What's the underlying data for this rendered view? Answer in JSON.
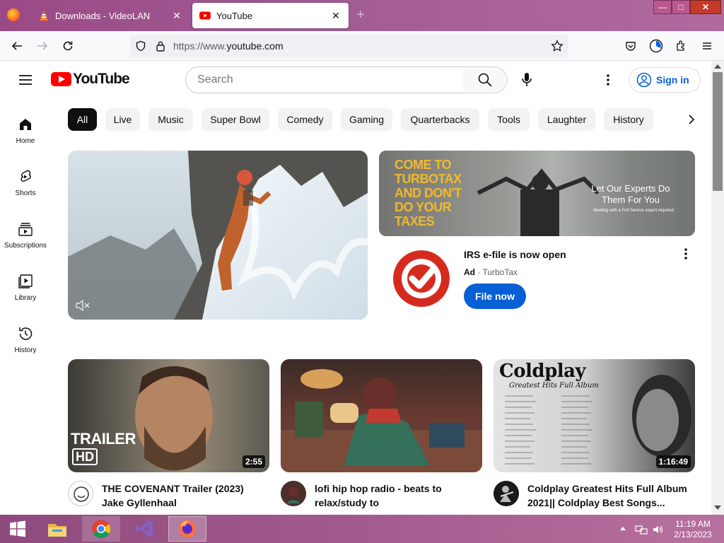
{
  "browser": {
    "tabs": [
      {
        "title": "Downloads - VideoLAN",
        "active": false,
        "icon": "vlc-cone-icon"
      },
      {
        "title": "YouTube",
        "active": true,
        "icon": "youtube-icon"
      }
    ],
    "url_prefix": "https://www.",
    "url_host": "youtube.com",
    "window_buttons": {
      "minimize": "—",
      "maximize": "□",
      "close": "✕"
    }
  },
  "youtube": {
    "logo_text": "YouTube",
    "search_placeholder": "Search",
    "signin_label": "Sign in",
    "sidebar": [
      {
        "label": "Home",
        "icon": "home-icon"
      },
      {
        "label": "Shorts",
        "icon": "shorts-icon"
      },
      {
        "label": "Subscriptions",
        "icon": "subscriptions-icon"
      },
      {
        "label": "Library",
        "icon": "library-icon"
      },
      {
        "label": "History",
        "icon": "history-icon"
      }
    ],
    "chips": [
      "All",
      "Live",
      "Music",
      "Super Bowl",
      "Comedy",
      "Gaming",
      "Quarterbacks",
      "Tools",
      "Laughter",
      "History"
    ],
    "active_chip": "All",
    "ad": {
      "banner_left_text": "COME TO TURBOTAX AND DON'T DO YOUR TAXES",
      "banner_right_title": "Let Our Experts Do Them For You",
      "banner_right_sub": "Meeting with a Full Service expert required",
      "title": "IRS e-file is now open",
      "ad_label": "Ad",
      "advertiser": "TurboTax",
      "cta_label": "File now"
    },
    "videos": [
      {
        "title_line1": "THE COVENANT Trailer (2023)",
        "title_line2": "Jake Gyllenhaal",
        "duration": "2:55",
        "overlay_text_1": "TRAILER",
        "overlay_text_2": "HD"
      },
      {
        "title_line1": "lofi hip hop radio - beats to",
        "title_line2": "relax/study to",
        "duration": ""
      },
      {
        "title_line1": "Coldplay Greatest Hits Full Album",
        "title_line2": "2021|| Coldplay Best Songs...",
        "duration": "1:16:49",
        "overlay_text_1": "Coldplay",
        "overlay_text_2": "Greatest Hits Full Album"
      }
    ]
  },
  "taskbar": {
    "time": "11:19 AM",
    "date": "2/13/2023",
    "apps": [
      "file-explorer-icon",
      "chrome-icon",
      "visual-studio-icon",
      "firefox-icon"
    ]
  },
  "colors": {
    "yt_red": "#ff0000",
    "link_blue": "#065fd4",
    "turbotax_red": "#d52b1e",
    "tab_strip": "#a05a92"
  }
}
